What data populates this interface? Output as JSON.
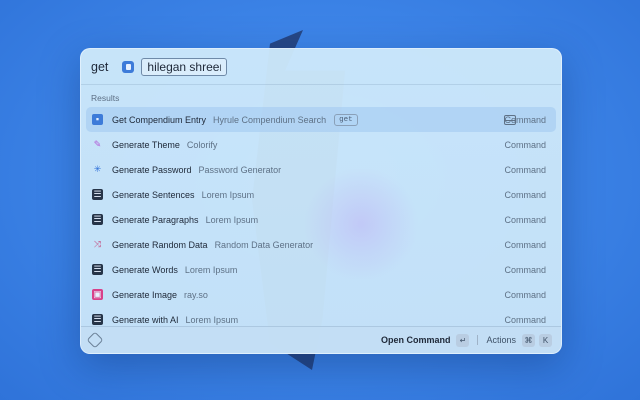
{
  "search": {
    "query": "get",
    "argument_value": "hilegan shreem"
  },
  "section_title": "Results",
  "results": [
    {
      "title": "Get Compendium Entry",
      "subtitle": "Hyrule Compendium Search",
      "tag": "get",
      "type": "Command",
      "icon": "compendium-icon",
      "icon_color": "#3d7bd9",
      "selected": true,
      "action_icon": "window-icon"
    },
    {
      "title": "Generate Theme",
      "subtitle": "Colorify",
      "type": "Command",
      "icon": "brush-icon",
      "icon_color": "#b25ad6"
    },
    {
      "title": "Generate Password",
      "subtitle": "Password Generator",
      "type": "Command",
      "icon": "asterisk-icon",
      "icon_color": "#2e6fd8"
    },
    {
      "title": "Generate Sentences",
      "subtitle": "Lorem Ipsum",
      "type": "Command",
      "icon": "text-block-icon",
      "icon_color": "#263448"
    },
    {
      "title": "Generate Paragraphs",
      "subtitle": "Lorem Ipsum",
      "type": "Command",
      "icon": "text-block-icon",
      "icon_color": "#263448"
    },
    {
      "title": "Generate Random Data",
      "subtitle": "Random Data Generator",
      "type": "Command",
      "icon": "shuffle-icon",
      "icon_color": "#c4467a"
    },
    {
      "title": "Generate Words",
      "subtitle": "Lorem Ipsum",
      "type": "Command",
      "icon": "text-block-icon",
      "icon_color": "#263448"
    },
    {
      "title": "Generate Image",
      "subtitle": "ray.so",
      "type": "Command",
      "icon": "image-icon",
      "icon_color": "#d8408a"
    },
    {
      "title": "Generate with AI",
      "subtitle": "Lorem Ipsum",
      "type": "Command",
      "icon": "text-block-icon",
      "icon_color": "#263448"
    }
  ],
  "footer": {
    "logo": "raycast-logo-icon",
    "primary_action": "Open Command",
    "primary_key": "↵",
    "secondary_action": "Actions",
    "secondary_keys": [
      "⌘",
      "K"
    ]
  }
}
